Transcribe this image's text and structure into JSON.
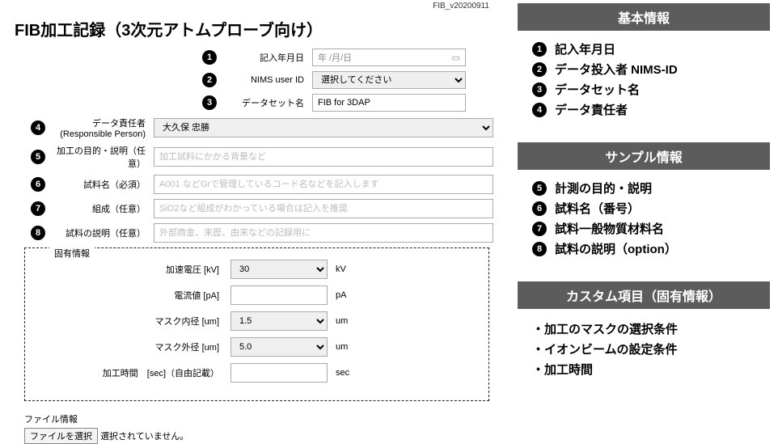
{
  "version": "FIB_v20200911",
  "title": "FIB加工記録（3次元アトムプローブ向け）",
  "form_top": [
    {
      "marker": "1",
      "label": "記入年月日",
      "type": "date",
      "placeholder": "年 /月/日"
    },
    {
      "marker": "2",
      "label": "NIMS user ID",
      "type": "select",
      "value": "選択してください"
    },
    {
      "marker": "3",
      "label": "データセット名",
      "type": "text",
      "value": "FIB for 3DAP"
    }
  ],
  "form_mid": [
    {
      "marker": "4",
      "label": "データ責任者(Responsible Person)",
      "type": "select",
      "value": "大久保 忠勝"
    },
    {
      "marker": "5",
      "label": "加工の目的・説明（任意）",
      "type": "text",
      "placeholder": "加工試料にかかる背景など"
    },
    {
      "marker": "6",
      "label": "試料名（必須）",
      "type": "text",
      "placeholder": "A001 などGrで管理しているコード名などを記入します"
    },
    {
      "marker": "7",
      "label": "組成（任意）",
      "type": "text",
      "placeholder": "SiO2など組成がわかっている場合は記入を推奨"
    },
    {
      "marker": "8",
      "label": "試料の説明（任意）",
      "type": "text",
      "placeholder": "外部商金、来歴、由来などの記録用に"
    }
  ],
  "spec_legend": "固有情報",
  "spec_rows": [
    {
      "label": "加速電圧 [kV]",
      "type": "select",
      "value": "30",
      "unit": "kV"
    },
    {
      "label": "電流値 [pA]",
      "type": "text",
      "value": "",
      "unit": "pA"
    },
    {
      "label": "マスク内径 [um]",
      "type": "select",
      "value": "1.5",
      "unit": "um"
    },
    {
      "label": "マスク外径 [um]",
      "type": "select",
      "value": "5.0",
      "unit": "um"
    },
    {
      "label": "加工時間　[sec]（自由記載）",
      "type": "text",
      "value": "",
      "unit": "sec"
    }
  ],
  "file_section_title": "ファイル情報",
  "file_btn": "ファイルを選択",
  "file_status": "選択されていません。",
  "groups": [
    {
      "header": "基本情報",
      "items": [
        {
          "marker": "1",
          "text": "記入年月日"
        },
        {
          "marker": "2",
          "text": "データ投入者 NIMS-ID"
        },
        {
          "marker": "3",
          "text": "データセット名"
        },
        {
          "marker": "4",
          "text": "データ責任者"
        }
      ]
    },
    {
      "header": "サンプル情報",
      "items": [
        {
          "marker": "5",
          "text": "計測の目的・説明"
        },
        {
          "marker": "6",
          "text": "試料名（番号）"
        },
        {
          "marker": "7",
          "text": "試料一般物質材料名"
        },
        {
          "marker": "8",
          "text": "試料の説明（option）"
        }
      ]
    },
    {
      "header": "カスタム項目（固有情報）",
      "bullets": [
        "・加工のマスクの選択条件",
        "・イオンビームの設定条件",
        "・加工時間"
      ]
    }
  ]
}
